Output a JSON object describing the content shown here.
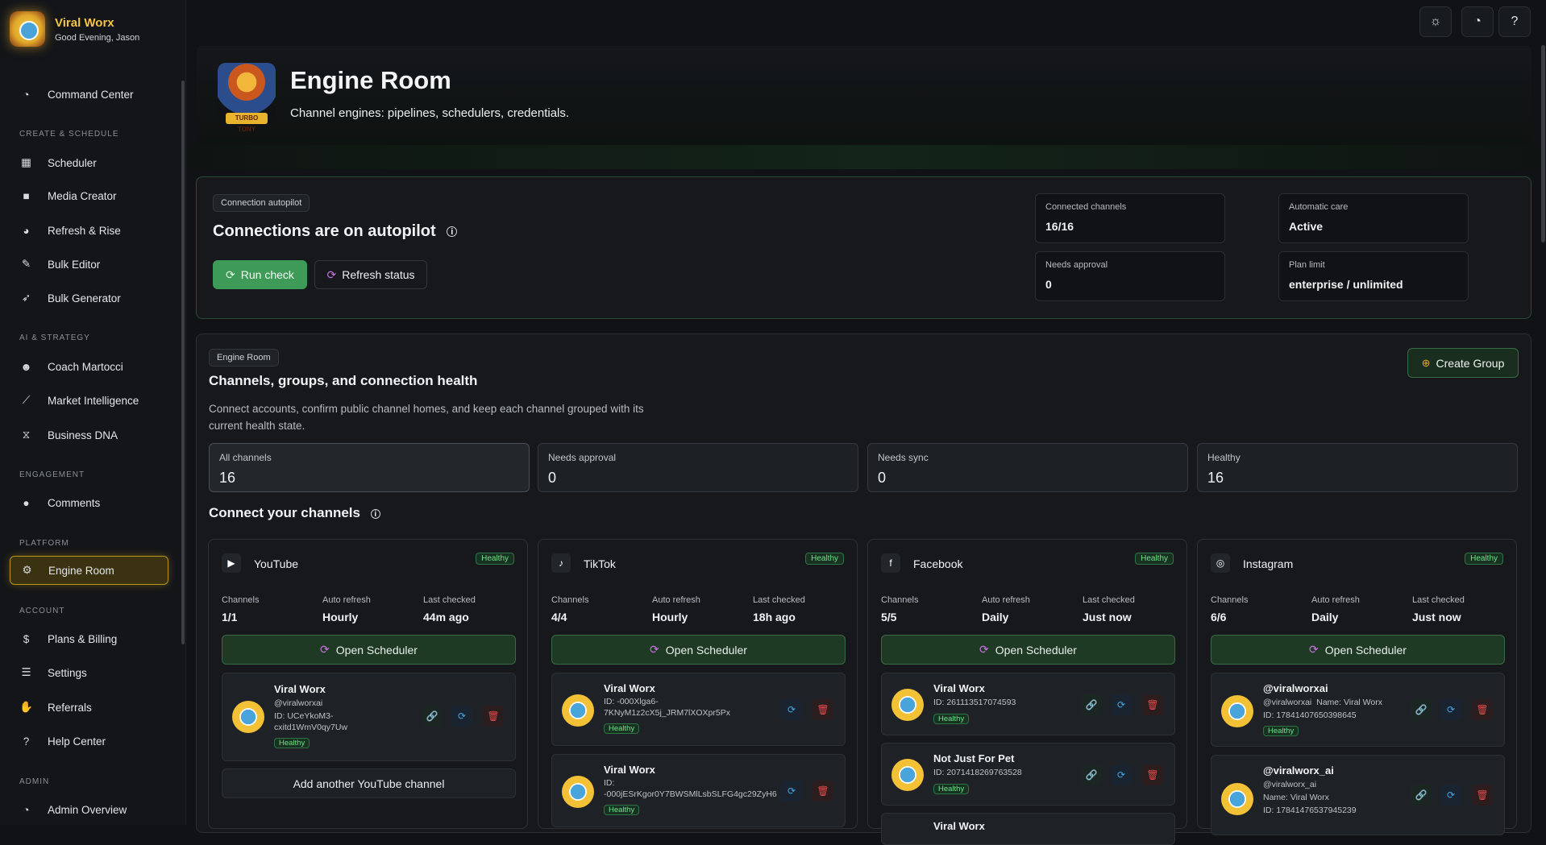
{
  "brand": {
    "name": "Viral Worx",
    "greeting": "Good Evening, Jason"
  },
  "nav": {
    "command_center": "Command Center",
    "sections": {
      "create": "CREATE & SCHEDULE",
      "ai": "AI & STRATEGY",
      "engagement": "ENGAGEMENT",
      "platform": "PLATFORM",
      "account": "ACCOUNT",
      "admin": "ADMIN"
    },
    "scheduler": "Scheduler",
    "media_creator": "Media Creator",
    "refresh_rise": "Refresh & Rise",
    "bulk_editor": "Bulk Editor",
    "bulk_generator": "Bulk Generator",
    "coach": "Coach Martocci",
    "market": "Market Intelligence",
    "dna": "Business DNA",
    "comments": "Comments",
    "engine_room": "Engine Room",
    "plans": "Plans & Billing",
    "settings": "Settings",
    "referrals": "Referrals",
    "help": "Help Center",
    "admin_overview": "Admin Overview"
  },
  "hero": {
    "title": "Engine Room",
    "subtitle": "Channel engines: pipelines, schedulers, credentials.",
    "mascot_text": "TURBO TONY"
  },
  "autopilot": {
    "pill": "Connection autopilot",
    "title": "Connections are on autopilot",
    "run_check": "Run check",
    "refresh_status": "Refresh status",
    "stats": [
      {
        "label": "Connected channels",
        "value": "16/16"
      },
      {
        "label": "Automatic care",
        "value": "Active"
      },
      {
        "label": "Needs approval",
        "value": "0"
      },
      {
        "label": "Plan limit",
        "value": "enterprise / unlimited"
      }
    ]
  },
  "engine": {
    "pill": "Engine Room",
    "title": "Channels, groups, and connection health",
    "desc1": "Connect accounts, confirm public channel homes, and keep each channel grouped with its",
    "desc2": "current health state.",
    "create_group": "Create Group",
    "stats": [
      {
        "label": "All channels",
        "value": "16"
      },
      {
        "label": "Needs approval",
        "value": "0"
      },
      {
        "label": "Needs sync",
        "value": "0"
      },
      {
        "label": "Healthy",
        "value": "16"
      }
    ],
    "connect_title": "Connect your channels"
  },
  "labels": {
    "channels": "Channels",
    "auto_refresh": "Auto refresh",
    "last_checked": "Last checked",
    "open_scheduler": "Open Scheduler",
    "healthy": "Healthy"
  },
  "platforms": [
    {
      "name": "YouTube",
      "channels": "1/1",
      "refresh": "Hourly",
      "checked": "44m ago",
      "accounts": [
        {
          "name": "Viral Worx",
          "handle": "@viralworxai",
          "id1": "ID: UCeYkoM3-",
          "id2": "cxitd1WmV0qy7Uw"
        }
      ],
      "add": "Add another YouTube channel"
    },
    {
      "name": "TikTok",
      "channels": "4/4",
      "refresh": "Hourly",
      "checked": "18h ago",
      "accounts": [
        {
          "name": "Viral Worx",
          "id1": "ID: -000Xlga6-",
          "id2": "7KNyM1z2cX5j_JRM7lXOXpr5Px"
        },
        {
          "name": "Viral Worx",
          "id1": "ID:",
          "id2": "-000jESrKgor0Y7BWSMlLsbSLFG4gc29ZyH6"
        }
      ]
    },
    {
      "name": "Facebook",
      "channels": "5/5",
      "refresh": "Daily",
      "checked": "Just now",
      "accounts": [
        {
          "name": "Viral Worx",
          "id1": "ID: 261113517074593"
        },
        {
          "name": "Not Just For Pet",
          "id1": "ID: 2071418269763528"
        },
        {
          "name": "Viral Worx"
        }
      ]
    },
    {
      "name": "Instagram",
      "channels": "6/6",
      "refresh": "Daily",
      "checked": "Just now",
      "accounts": [
        {
          "name": "@viralworxai",
          "handle": "@viralworxai",
          "named": "Name: Viral Worx",
          "id1": "ID: 17841407650398645"
        },
        {
          "name": "@viralworx_ai",
          "handle": "@viralworx_ai",
          "named": "Name: Viral Worx",
          "id1": "ID: 17841476537945239"
        }
      ]
    }
  ]
}
